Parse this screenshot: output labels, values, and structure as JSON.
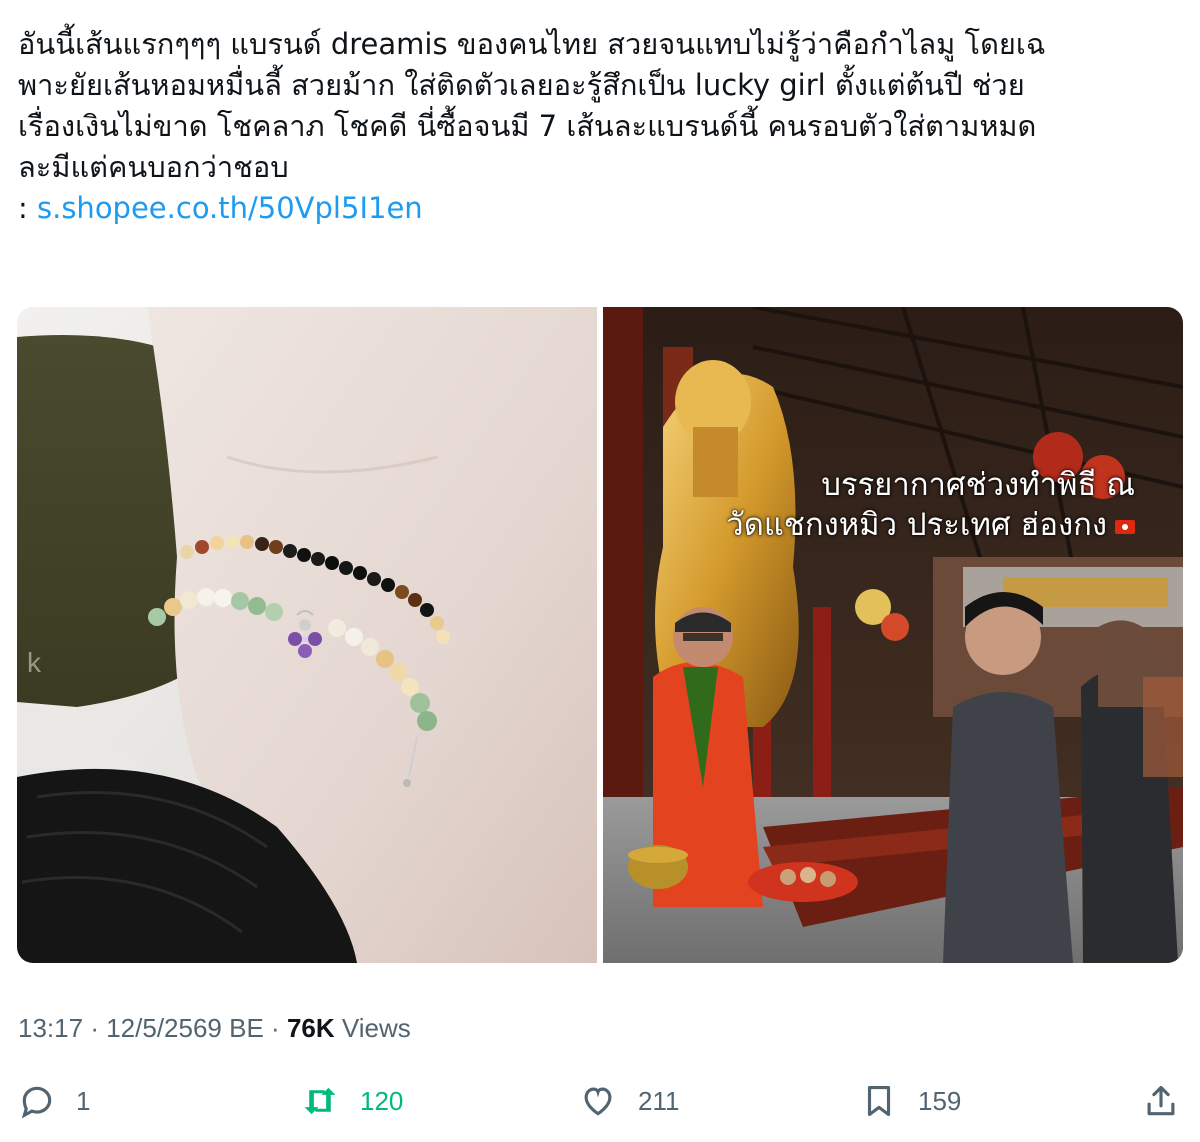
{
  "tweet": {
    "text_lines": [
      "อันนี้เส้นแรกๆๆๆ แบรนด์ dreamis ของคนไทย สวยจนแทบไม่รู้ว่าคือกำไลมู โดยเฉ",
      "พาะยัยเส้นหอมหมื่นลี้ สวยม้าก ใส่ติดตัวเลยอะรู้สึกเป็น lucky girl ตั้งแต่ต้นปี ช่วย",
      "เรื่องเงินไม่ขาด โชคลาภ โชคดี นี่ซื้อจนมี 7 เส้นละแบรนด์นี้ คนรอบตัวใส่ตามหมด",
      "ละมีแต่คนบอกว่าชอบ"
    ],
    "link_prefix": ": ",
    "link_text": "s.shopee.co.th/50Vpl5I1en"
  },
  "media": {
    "image_left_name": "bracelet-on-wrist-photo",
    "image_right_name": "temple-ceremony-photo",
    "overlay_caption_lines": [
      "บรรยากาศช่วงทำพิธี ณ",
      "วัดแชกงหมิว ประเทศ ฮ่องกง"
    ]
  },
  "meta": {
    "time": "13:17",
    "separator": "·",
    "date": "12/5/2569 BE",
    "views_count": "76K",
    "views_label": "Views"
  },
  "actions": {
    "reply_icon": "reply-icon",
    "reply_count": "1",
    "retweet_icon": "retweet-icon",
    "retweet_count": "120",
    "like_icon": "heart-icon",
    "like_count": "211",
    "bookmark_icon": "bookmark-icon",
    "bookmark_count": "159",
    "share_icon": "share-icon"
  },
  "colors": {
    "text": "#0f1419",
    "secondary": "#536471",
    "link": "#1d9bf0",
    "retweeted": "#00ba7c"
  }
}
